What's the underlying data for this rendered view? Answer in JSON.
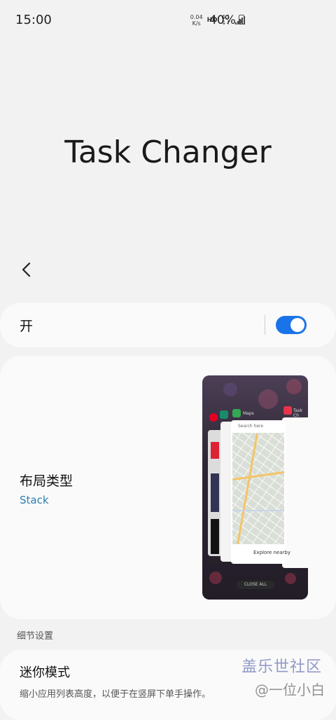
{
  "status": {
    "time": "15:00",
    "speed_value": "0.04",
    "speed_unit": "K/s",
    "hd": "HD",
    "network": "4G",
    "battery": "40%"
  },
  "app_title": "Task Changer",
  "toggle": {
    "label": "开",
    "state": "on"
  },
  "layout": {
    "title": "布局类型",
    "value": "Stack",
    "preview": {
      "maps_label": "Maps",
      "task_label": "Task Ch",
      "search_label": "Search here",
      "explore_label": "Explore nearby",
      "close_all_label": "CLOSE ALL"
    }
  },
  "section": {
    "title": "细节设置"
  },
  "mini_mode": {
    "title": "迷你模式",
    "description": "缩小应用列表高度，以便于在竖屏下单手操作。"
  },
  "watermark": {
    "line1": "盖乐世社区",
    "line2": "@一位小白"
  },
  "colors": {
    "accent": "#1a73e8",
    "value_text": "#2a7fb5"
  }
}
